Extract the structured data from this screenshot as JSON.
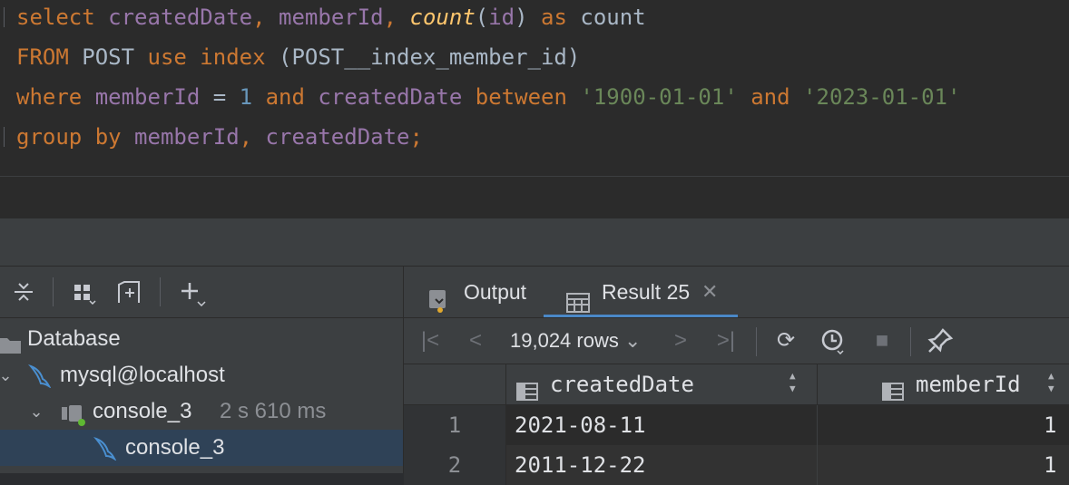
{
  "editor": {
    "lines": [
      [
        {
          "t": "select",
          "c": "kw"
        },
        {
          "t": " ",
          "c": "plain"
        },
        {
          "t": "createdDate",
          "c": "col"
        },
        {
          "t": ", ",
          "c": "kw"
        },
        {
          "t": "memberId",
          "c": "col"
        },
        {
          "t": ", ",
          "c": "kw"
        },
        {
          "t": "count",
          "c": "fn"
        },
        {
          "t": "(",
          "c": "plain"
        },
        {
          "t": "id",
          "c": "col"
        },
        {
          "t": ") ",
          "c": "plain"
        },
        {
          "t": "as",
          "c": "kw"
        },
        {
          "t": " count",
          "c": "plain"
        }
      ],
      [
        {
          "t": "FROM",
          "c": "kw"
        },
        {
          "t": " POST ",
          "c": "plain"
        },
        {
          "t": "use index",
          "c": "kw"
        },
        {
          "t": " (POST__index_member_id)",
          "c": "plain"
        }
      ],
      [
        {
          "t": "where",
          "c": "kw"
        },
        {
          "t": " ",
          "c": "plain"
        },
        {
          "t": "memberId",
          "c": "col"
        },
        {
          "t": " = ",
          "c": "plain"
        },
        {
          "t": "1",
          "c": "num"
        },
        {
          "t": " ",
          "c": "plain"
        },
        {
          "t": "and",
          "c": "kw"
        },
        {
          "t": " ",
          "c": "plain"
        },
        {
          "t": "createdDate",
          "c": "col"
        },
        {
          "t": " ",
          "c": "plain"
        },
        {
          "t": "between",
          "c": "kw"
        },
        {
          "t": " ",
          "c": "plain"
        },
        {
          "t": "'1900-01-01'",
          "c": "str"
        },
        {
          "t": " ",
          "c": "plain"
        },
        {
          "t": "and",
          "c": "kw"
        },
        {
          "t": " ",
          "c": "plain"
        },
        {
          "t": "'2023-01-01'",
          "c": "str"
        }
      ],
      [
        {
          "t": "group by",
          "c": "kw"
        },
        {
          "t": " ",
          "c": "plain"
        },
        {
          "t": "memberId",
          "c": "col"
        },
        {
          "t": ", ",
          "c": "kw"
        },
        {
          "t": "createdDate",
          "c": "col"
        },
        {
          "t": ";",
          "c": "kw"
        }
      ]
    ]
  },
  "db_tree": {
    "root_label": "Database",
    "connection_label": "mysql@localhost",
    "console_label": "console_3",
    "console_time": "2 s 610 ms",
    "child_label": "console_3"
  },
  "results": {
    "tab_output": "Output",
    "tab_result": "Result 25",
    "rows_count": "19,024 rows",
    "columns": [
      "createdDate",
      "memberId"
    ],
    "rows": [
      {
        "n": "1",
        "createdDate": "2021-08-11",
        "memberId": "1"
      },
      {
        "n": "2",
        "createdDate": "2011-12-22",
        "memberId": "1"
      }
    ]
  },
  "colors": {
    "keyword": "#cc7832",
    "column": "#9876aa",
    "function": "#ffc66d",
    "string": "#6a8759",
    "number": "#6897bb",
    "selection": "#2f4257",
    "accent": "#4a88c7"
  }
}
